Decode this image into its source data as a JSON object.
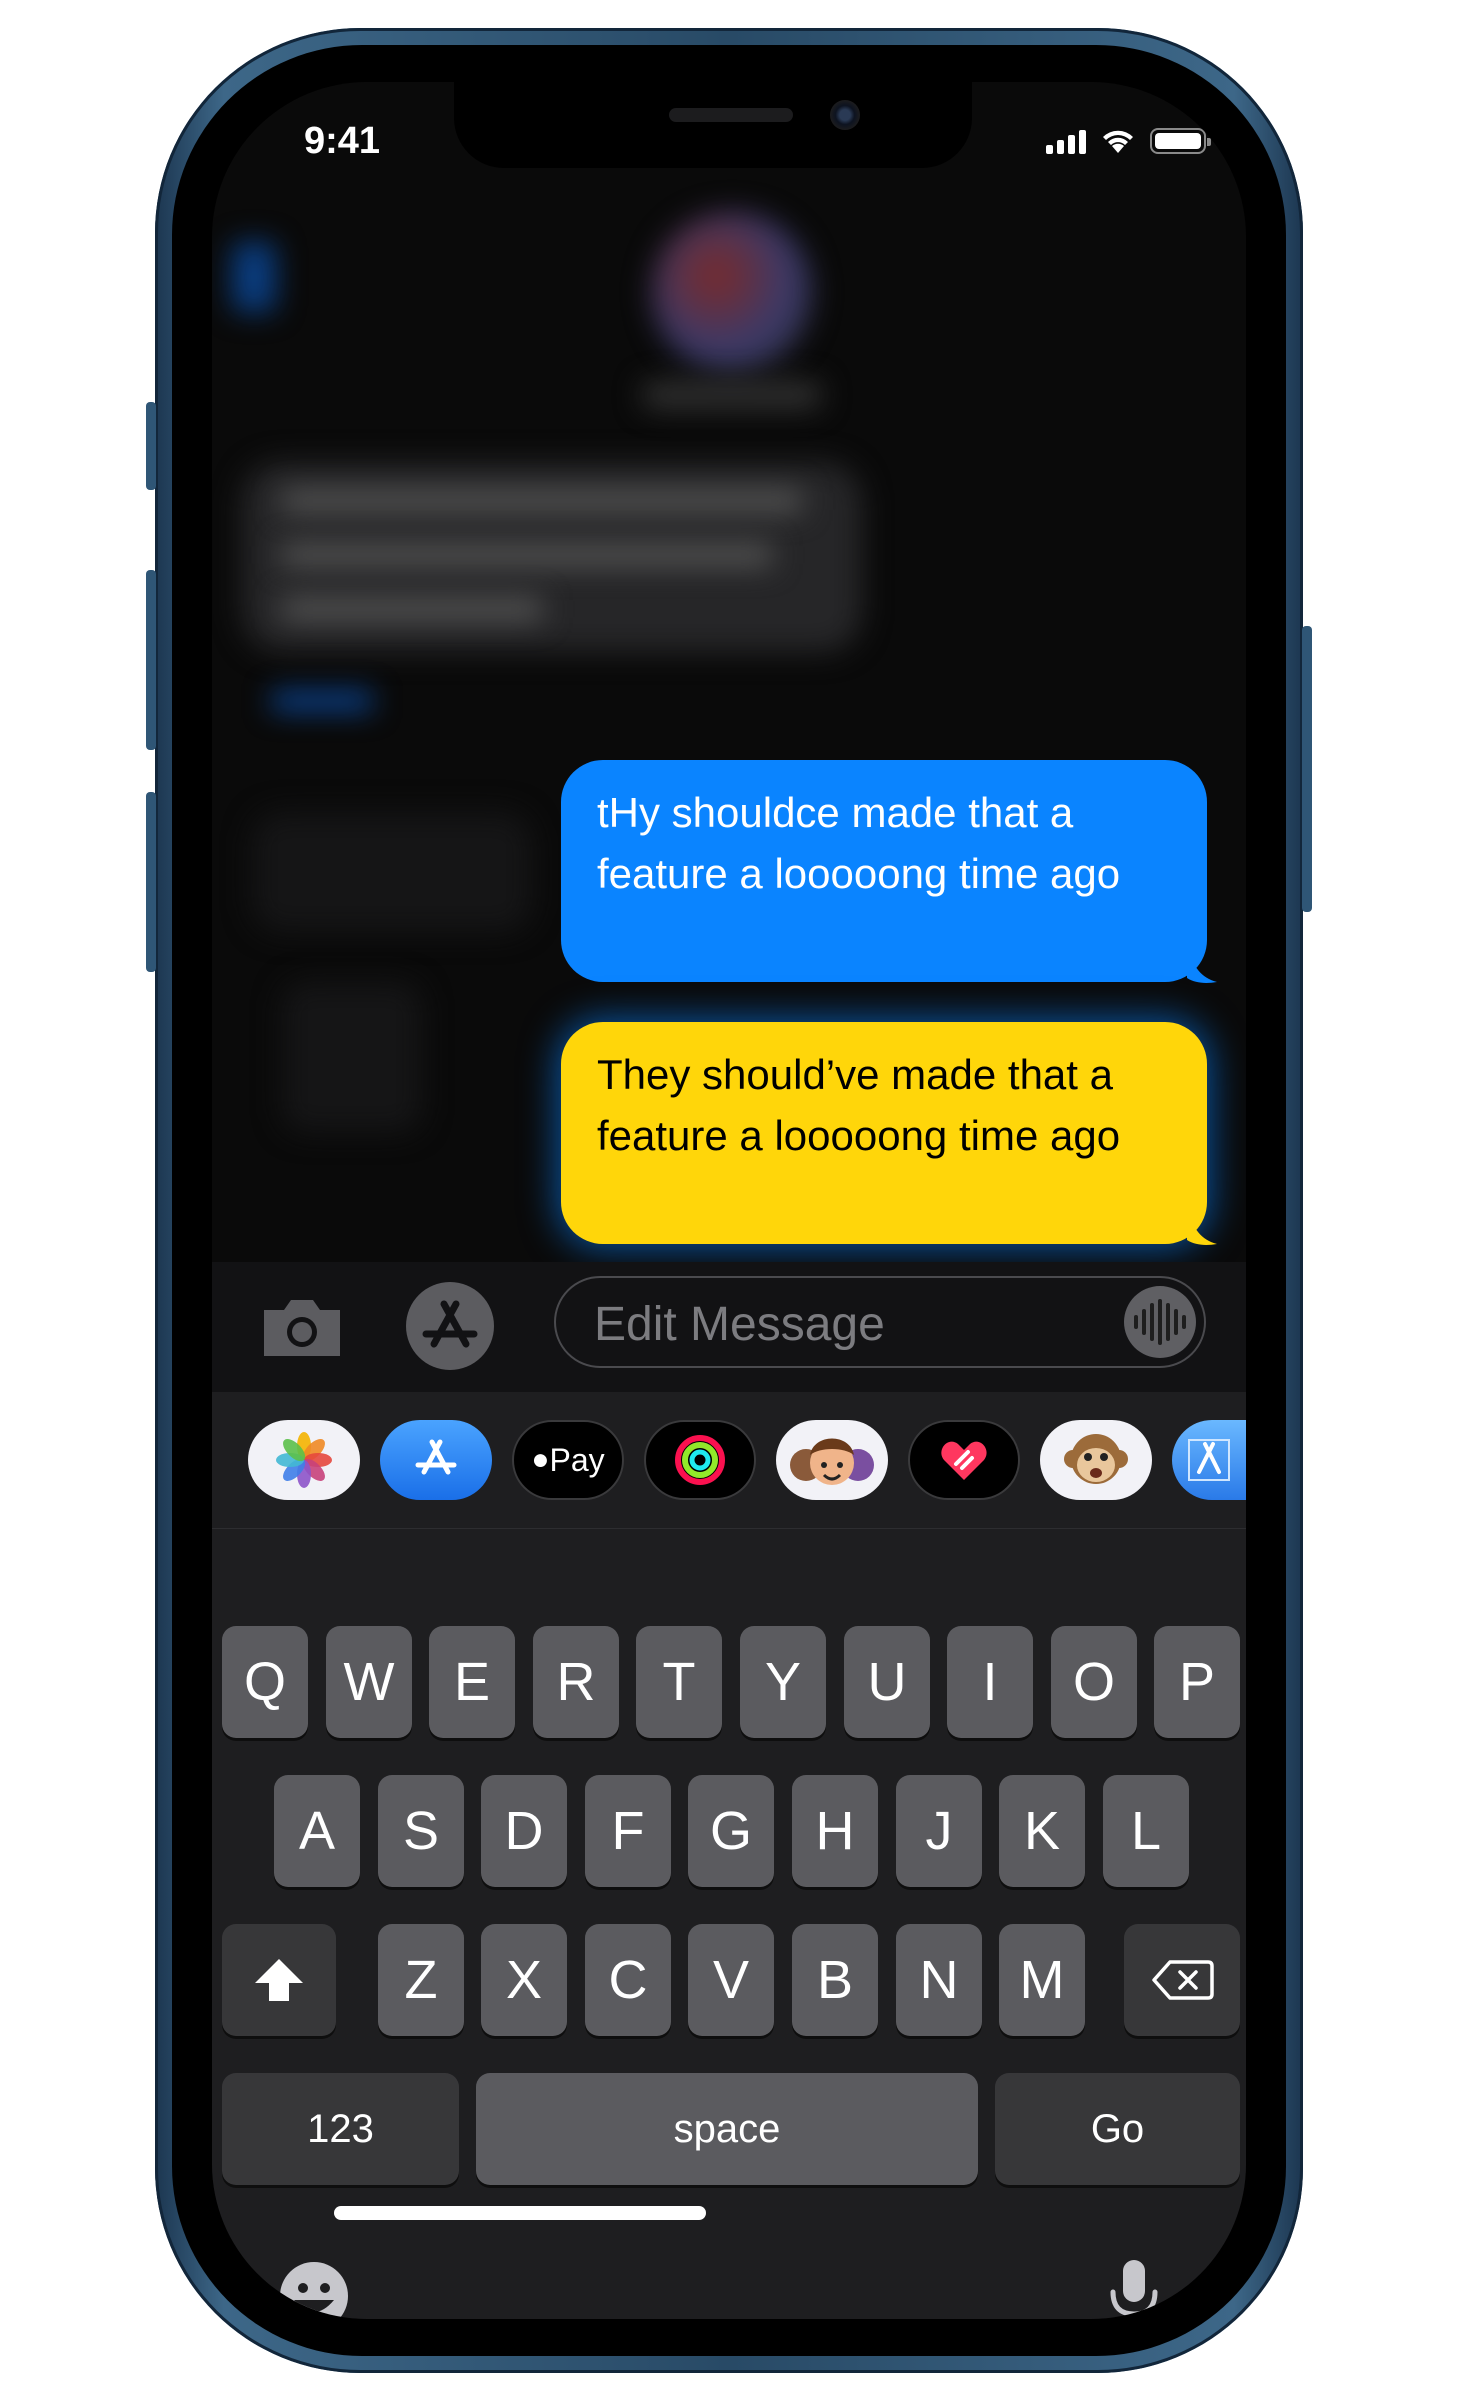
{
  "status_bar": {
    "time": "9:41"
  },
  "messages": [
    {
      "text": "tHy shouldce made that a feature a looooong time ago",
      "color": "#0a84ff"
    },
    {
      "text": "They should’ve made that a feature a looooong time ago",
      "color": "#ffd60a"
    }
  ],
  "input": {
    "placeholder": "Edit Message"
  },
  "app_strip": [
    {
      "icon": "photos-icon"
    },
    {
      "icon": "app-store-icon"
    },
    {
      "icon": "apple-pay-icon",
      "label": "Pay"
    },
    {
      "icon": "activity-icon"
    },
    {
      "icon": "memoji-icon"
    },
    {
      "icon": "digital-touch-icon"
    },
    {
      "icon": "animoji-icon"
    },
    {
      "icon": "app-store-partial-icon"
    }
  ],
  "keyboard": {
    "row1": [
      "Q",
      "W",
      "E",
      "R",
      "T",
      "Y",
      "U",
      "I",
      "O",
      "P"
    ],
    "row2": [
      "A",
      "S",
      "D",
      "F",
      "G",
      "H",
      "J",
      "K",
      "L"
    ],
    "row3": [
      "Z",
      "X",
      "C",
      "V",
      "B",
      "N",
      "M"
    ],
    "numbers_label": "123",
    "space_label": "space",
    "go_label": "Go"
  },
  "colors": {
    "accent_blue": "#0a84ff",
    "highlight_yellow": "#ffd60a",
    "frame_blue": "#3d6788"
  }
}
